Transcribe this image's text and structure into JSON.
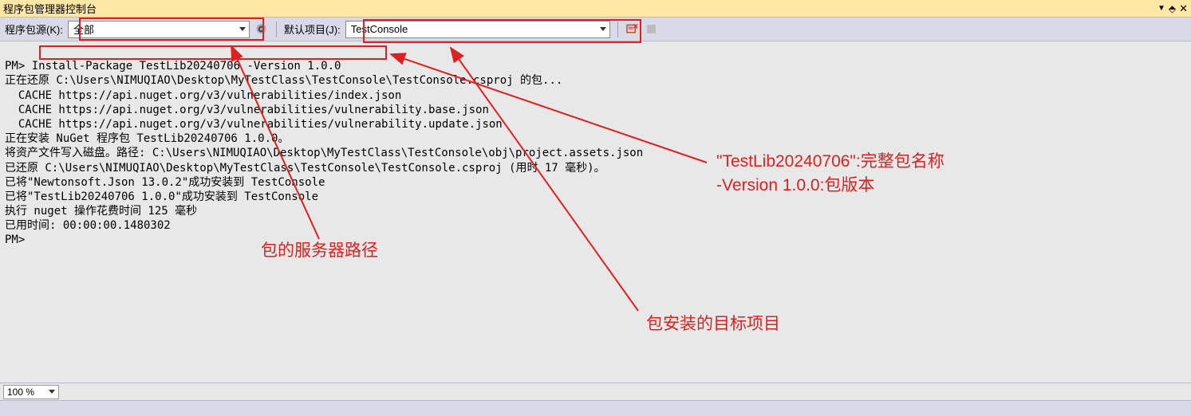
{
  "title": "程序包管理器控制台",
  "toolbar": {
    "source_label": "程序包源(K):",
    "source_value": "全部",
    "project_label": "默认项目(J):",
    "project_value": "TestConsole"
  },
  "console": {
    "lines": [
      "PM> Install-Package TestLib20240706 -Version 1.0.0",
      "正在还原 C:\\Users\\NIMUQIAO\\Desktop\\MyTestClass\\TestConsole\\TestConsole.csproj 的包...",
      "  CACHE https://api.nuget.org/v3/vulnerabilities/index.json",
      "  CACHE https://api.nuget.org/v3/vulnerabilities/vulnerability.base.json",
      "  CACHE https://api.nuget.org/v3/vulnerabilities/vulnerability.update.json",
      "正在安装 NuGet 程序包 TestLib20240706 1.0.0。",
      "将资产文件写入磁盘。路径: C:\\Users\\NIMUQIAO\\Desktop\\MyTestClass\\TestConsole\\obj\\project.assets.json",
      "已还原 C:\\Users\\NIMUQIAO\\Desktop\\MyTestClass\\TestConsole\\TestConsole.csproj (用时 17 毫秒)。",
      "已将\"Newtonsoft.Json 13.0.2\"成功安装到 TestConsole",
      "已将\"TestLib20240706 1.0.0\"成功安装到 TestConsole",
      "执行 nuget 操作花费时间 125 毫秒",
      "已用时间: 00:00:00.1480302",
      "PM> "
    ]
  },
  "zoom": {
    "value": "100 %"
  },
  "annotations": {
    "package_name": "\"TestLib20240706\":完整包名称",
    "version": "-Version 1.0.0:包版本",
    "server_path": "包的服务器路径",
    "target_project": "包安装的目标项目"
  }
}
